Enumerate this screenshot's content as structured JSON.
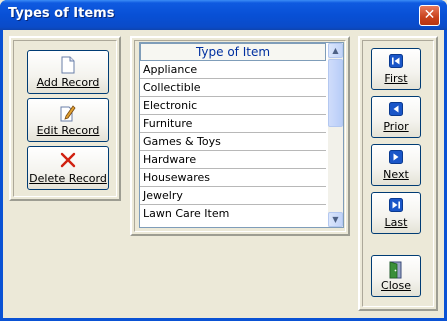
{
  "window": {
    "title": "Types of Items",
    "close_label": "✕"
  },
  "actions": {
    "add_label": "Add Record",
    "edit_label": "Edit Record",
    "delete_label": "Delete Record"
  },
  "list": {
    "header": "Type of Item",
    "items": [
      "Appliance",
      "Collectible",
      "Electronic",
      "Furniture",
      "Games & Toys",
      "Hardware",
      "Housewares",
      "Jewelry",
      "Lawn Care Item"
    ]
  },
  "navigation": {
    "first_label": "First",
    "prior_label": "Prior",
    "next_label": "Next",
    "last_label": "Last",
    "close_label": "Close"
  },
  "colors": {
    "titlebar": "#0a52d4",
    "nav_icon": "#1a56c8",
    "delete_icon": "#d02010"
  }
}
